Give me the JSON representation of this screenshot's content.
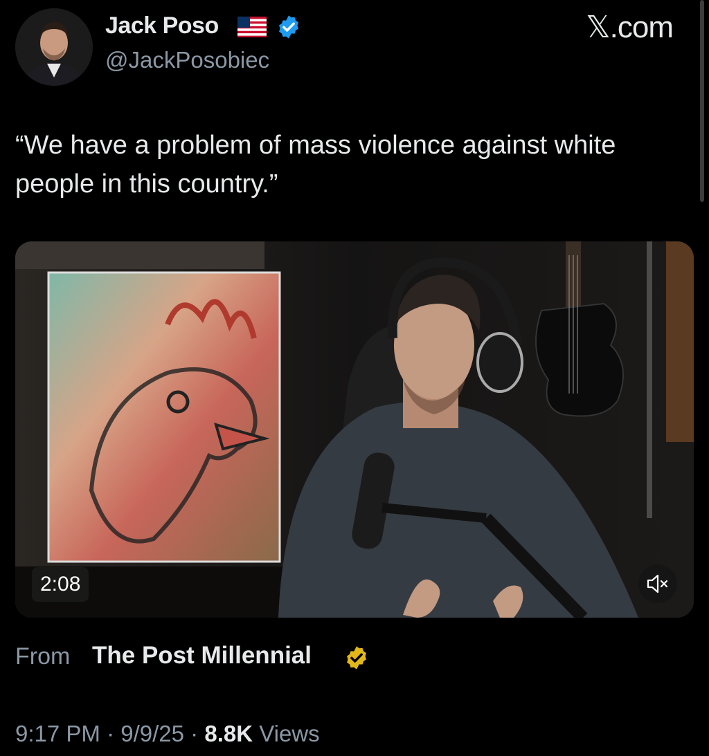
{
  "author": {
    "display_name": "Jack Poso",
    "handle": "@JackPosobiec",
    "flag_icon": "us-flag-icon",
    "verified_icon": "blue-verified-badge-icon",
    "verified_color": "#1d9bf0"
  },
  "site_mark": "𝕏.com",
  "tweet": {
    "text": "“We have a problem of mass violence against white people in this country.”"
  },
  "video": {
    "duration": "2:08",
    "mute_icon": "muted-speaker-icon"
  },
  "source": {
    "from_label": "From",
    "name": "The Post Millennial",
    "badge_icon": "gold-verified-badge-icon",
    "badge_color": "#e2b719"
  },
  "meta": {
    "time": "9:17 PM",
    "separator": "·",
    "date": "9/9/25",
    "views_count": "8.8K",
    "views_label": "Views"
  },
  "colors": {
    "background": "#000000",
    "primary_text": "#e7e9ea",
    "secondary_text": "#8b98a5"
  }
}
